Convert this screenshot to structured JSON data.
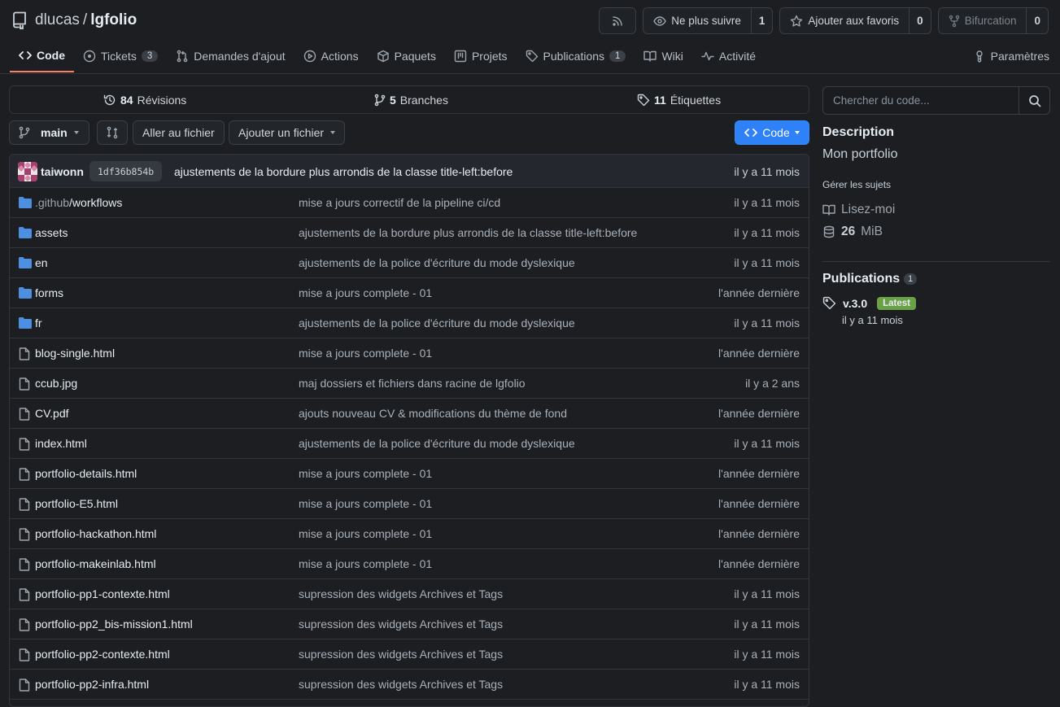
{
  "repo": {
    "owner": "dlucas",
    "separator": "/",
    "name": "lgfolio"
  },
  "header_actions": {
    "unwatch_label": "Ne plus suivre",
    "watch_count": "1",
    "star_label": "Ajouter aux favoris",
    "star_count": "0",
    "fork_label": "Bifurcation",
    "fork_count": "0"
  },
  "tabs": [
    {
      "label": "Code",
      "icon": "code-icon"
    },
    {
      "label": "Tickets",
      "count": "3",
      "icon": "issue-icon"
    },
    {
      "label": "Demandes d'ajout",
      "icon": "pull-request-icon"
    },
    {
      "label": "Actions",
      "icon": "play-icon"
    },
    {
      "label": "Paquets",
      "icon": "package-icon"
    },
    {
      "label": "Projets",
      "icon": "project-icon"
    },
    {
      "label": "Publications",
      "count": "1",
      "icon": "tag-icon"
    },
    {
      "label": "Wiki",
      "icon": "book-icon"
    },
    {
      "label": "Activité",
      "icon": "pulse-icon"
    }
  ],
  "settings_label": "Paramètres",
  "stats": {
    "revisions_count": "84",
    "revisions_label": "Révisions",
    "branches_count": "5",
    "branches_label": "Branches",
    "tags_count": "11",
    "tags_label": "Étiquettes"
  },
  "toolbar": {
    "branch": "main",
    "goto_file": "Aller au fichier",
    "add_file": "Ajouter un fichier",
    "code_button": "Code"
  },
  "latest_commit": {
    "author": "taiwonn",
    "sha": "1df36b854b",
    "message": "ajustements de la bordure plus arrondis de la classe title-left:before",
    "time": "il y a 11 mois"
  },
  "files": [
    {
      "type": "dir",
      "prefix": ".github",
      "name": "/workflows",
      "message": "mise a jours correctif de la pipeline ci/cd",
      "time": "il y a 11 mois"
    },
    {
      "type": "dir",
      "prefix": "",
      "name": "assets",
      "message": "ajustements de la bordure plus arrondis de la classe title-left:before",
      "time": "il y a 11 mois"
    },
    {
      "type": "dir",
      "prefix": "",
      "name": "en",
      "message": "ajustements de la police d'écriture du mode dyslexique",
      "time": "il y a 11 mois"
    },
    {
      "type": "dir",
      "prefix": "",
      "name": "forms",
      "message": "mise a jours complete - 01",
      "time": "l'année dernière"
    },
    {
      "type": "dir",
      "prefix": "",
      "name": "fr",
      "message": "ajustements de la police d'écriture du mode dyslexique",
      "time": "il y a 11 mois"
    },
    {
      "type": "file",
      "prefix": "",
      "name": "blog-single.html",
      "message": "mise a jours complete - 01",
      "time": "l'année dernière"
    },
    {
      "type": "file",
      "prefix": "",
      "name": "ccub.jpg",
      "message": "maj dossiers et fichiers dans racine de lgfolio",
      "time": "il y a 2 ans"
    },
    {
      "type": "file",
      "prefix": "",
      "name": "CV.pdf",
      "message": "ajouts nouveau CV & modifications du thème de fond",
      "time": "l'année dernière"
    },
    {
      "type": "file",
      "prefix": "",
      "name": "index.html",
      "message": "ajustements de la police d'écriture du mode dyslexique",
      "time": "il y a 11 mois"
    },
    {
      "type": "file",
      "prefix": "",
      "name": "portfolio-details.html",
      "message": "mise a jours complete - 01",
      "time": "l'année dernière"
    },
    {
      "type": "file",
      "prefix": "",
      "name": "portfolio-E5.html",
      "message": "mise a jours complete - 01",
      "time": "l'année dernière"
    },
    {
      "type": "file",
      "prefix": "",
      "name": "portfolio-hackathon.html",
      "message": "mise a jours complete - 01",
      "time": "l'année dernière"
    },
    {
      "type": "file",
      "prefix": "",
      "name": "portfolio-makeinlab.html",
      "message": "mise a jours complete - 01",
      "time": "l'année dernière"
    },
    {
      "type": "file",
      "prefix": "",
      "name": "portfolio-pp1-contexte.html",
      "message": "supression des widgets Archives et Tags",
      "time": "il y a 11 mois"
    },
    {
      "type": "file",
      "prefix": "",
      "name": "portfolio-pp2_bis-mission1.html",
      "message": "supression des widgets Archives et Tags",
      "time": "il y a 11 mois"
    },
    {
      "type": "file",
      "prefix": "",
      "name": "portfolio-pp2-contexte.html",
      "message": "supression des widgets Archives et Tags",
      "time": "il y a 11 mois"
    },
    {
      "type": "file",
      "prefix": "",
      "name": "portfolio-pp2-infra.html",
      "message": "supression des widgets Archives et Tags",
      "time": "il y a 11 mois"
    }
  ],
  "sidebar": {
    "search_placeholder": "Chercher du code...",
    "description_title": "Description",
    "description": "Mon portfolio",
    "manage_topics": "Gérer les sujets",
    "readme": "Lisez-moi",
    "size_value": "26",
    "size_unit": "MiB",
    "publications_title": "Publications",
    "publications_count": "1",
    "release_tag": "v.3.0",
    "release_badge": "Latest",
    "release_time": "il y a 11 mois"
  },
  "colors": {
    "accent": "#f78166",
    "link": "#2f81f7",
    "folder": "#4d8fe0",
    "latest": "#6ba146"
  }
}
